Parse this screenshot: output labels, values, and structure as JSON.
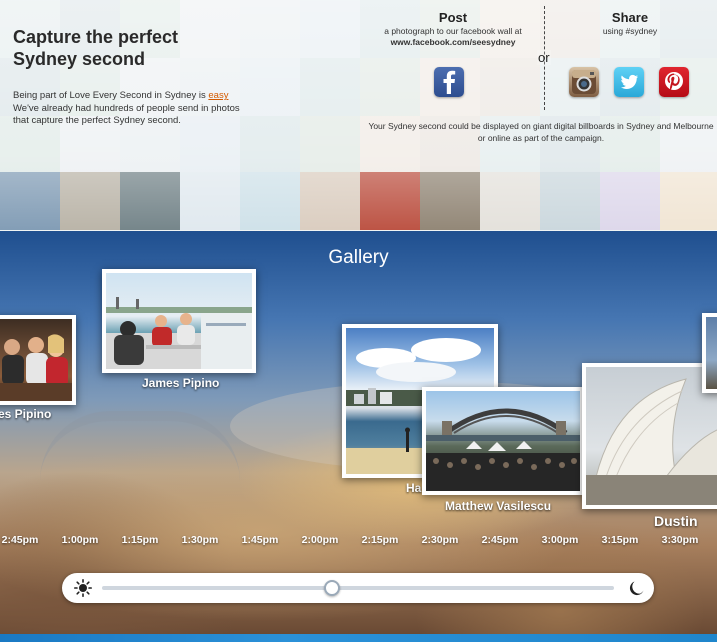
{
  "intro": {
    "title": "Capture the perfect Sydney second",
    "body_before_link": "Being part of Love Every Second in Sydney is ",
    "body_link": "easy",
    "body_after_link": "We've already had hundreds of people send in photos that capture the perfect Sydney second."
  },
  "post": {
    "heading": "Post",
    "line1": "a photograph to our facebook wall at",
    "url": "www.facebook.com/seesydney"
  },
  "or_label": "or",
  "share": {
    "heading": "Share",
    "line1": "using #sydney"
  },
  "social_icons": [
    "facebook-icon",
    "instagram-icon",
    "twitter-icon",
    "pinterest-icon"
  ],
  "billboard_text": "Your Sydney second could be displayed on giant digital billboards in Sydney and Melbourne or online as part of the campaign.",
  "gallery": {
    "title": "Gallery",
    "captions": {
      "left_partial": "es Pipino",
      "james": "James Pipino",
      "ha_partial": "Ha",
      "matthew": "Matthew Vasilescu",
      "dustin": "Dustin"
    },
    "timeline": [
      "2:45pm",
      "1:00pm",
      "1:15pm",
      "1:30pm",
      "1:45pm",
      "2:00pm",
      "2:15pm",
      "2:30pm",
      "2:45pm",
      "3:00pm",
      "3:15pm",
      "3:30pm"
    ],
    "slider_position_fraction": 0.45
  },
  "colors": {
    "link": "#d35a00",
    "accent_blue": "#1a79c3",
    "facebook": "#3b5998",
    "twitter": "#2aa8d8",
    "pinterest": "#cb2027"
  }
}
